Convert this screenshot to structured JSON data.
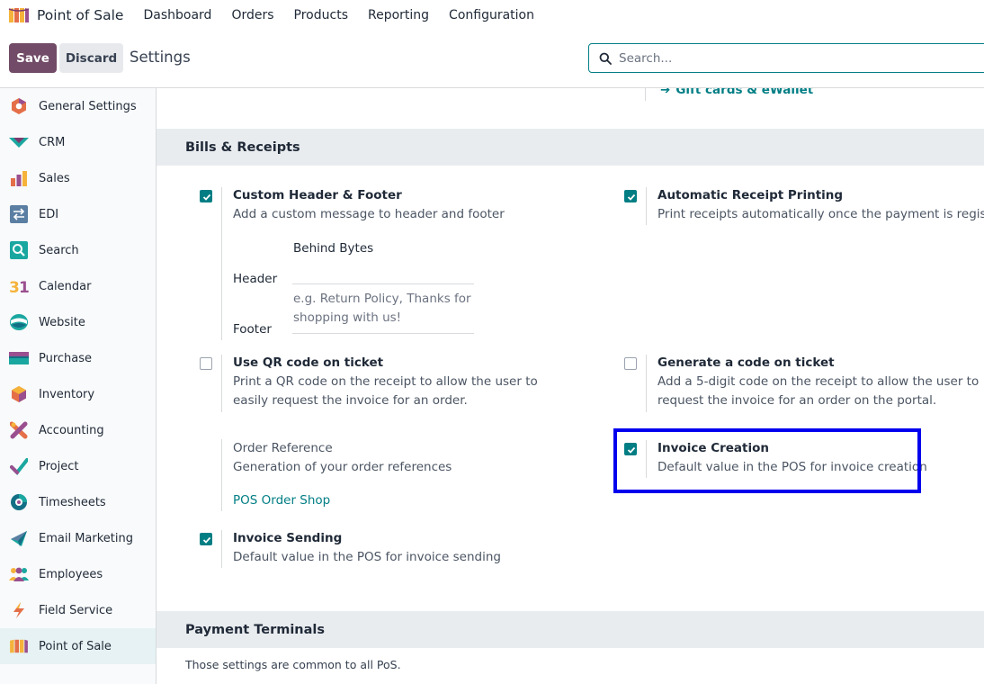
{
  "app": {
    "name": "Point of Sale"
  },
  "topmenu": [
    "Dashboard",
    "Orders",
    "Products",
    "Reporting",
    "Configuration"
  ],
  "control": {
    "save_label": "Save",
    "discard_label": "Discard",
    "title": "Settings",
    "search_placeholder": "Search..."
  },
  "sidebar": {
    "active": "Point of Sale",
    "items": [
      {
        "label": "General Settings",
        "icon": "general-settings-icon"
      },
      {
        "label": "CRM",
        "icon": "crm-icon"
      },
      {
        "label": "Sales",
        "icon": "sales-icon"
      },
      {
        "label": "EDI",
        "icon": "edi-icon"
      },
      {
        "label": "Search",
        "icon": "search-app-icon"
      },
      {
        "label": "Calendar",
        "icon": "calendar-icon"
      },
      {
        "label": "Website",
        "icon": "website-icon"
      },
      {
        "label": "Purchase",
        "icon": "purchase-icon"
      },
      {
        "label": "Inventory",
        "icon": "inventory-icon"
      },
      {
        "label": "Accounting",
        "icon": "accounting-icon"
      },
      {
        "label": "Project",
        "icon": "project-icon"
      },
      {
        "label": "Timesheets",
        "icon": "timesheets-icon"
      },
      {
        "label": "Email Marketing",
        "icon": "email-marketing-icon"
      },
      {
        "label": "Employees",
        "icon": "employees-icon"
      },
      {
        "label": "Field Service",
        "icon": "field-service-icon"
      },
      {
        "label": "Point of Sale",
        "icon": "point-of-sale-icon"
      }
    ]
  },
  "main": {
    "gift_link": "Gift cards & eWallet",
    "bills": {
      "title": "Bills & Receipts",
      "custom_header": {
        "title": "Custom Header & Footer",
        "desc": "Add a custom message to header and footer",
        "checked": true,
        "header_label": "Header",
        "header_value": "Behind Bytes",
        "footer_label": "Footer",
        "footer_placeholder": "e.g. Return Policy, Thanks for shopping with us!"
      },
      "auto_print": {
        "title": "Automatic Receipt Printing",
        "desc": "Print receipts automatically once the payment is registered.",
        "checked": true
      },
      "qr_code": {
        "title": "Use QR code on ticket",
        "desc": "Print a QR code on the receipt to allow the user to easily request the invoice for an order.",
        "checked": false
      },
      "gen_code": {
        "title": "Generate a code on ticket",
        "desc": "Add a 5-digit code on the receipt to allow the user to request the invoice for an order on the portal.",
        "checked": false
      },
      "order_ref": {
        "title": "Order Reference",
        "desc": "Generation of your order references",
        "link": "POS Order Shop"
      },
      "invoice_creation": {
        "title": "Invoice Creation",
        "desc": "Default value in the POS for invoice creation",
        "checked": true
      },
      "invoice_sending": {
        "title": "Invoice Sending",
        "desc": "Default value in the POS for invoice sending",
        "checked": true
      }
    },
    "payment": {
      "title": "Payment Terminals",
      "note": "Those settings are common to all PoS."
    }
  },
  "colors": {
    "brand": "#714b67",
    "accent": "#017e84",
    "highlight": "#0000ee"
  }
}
